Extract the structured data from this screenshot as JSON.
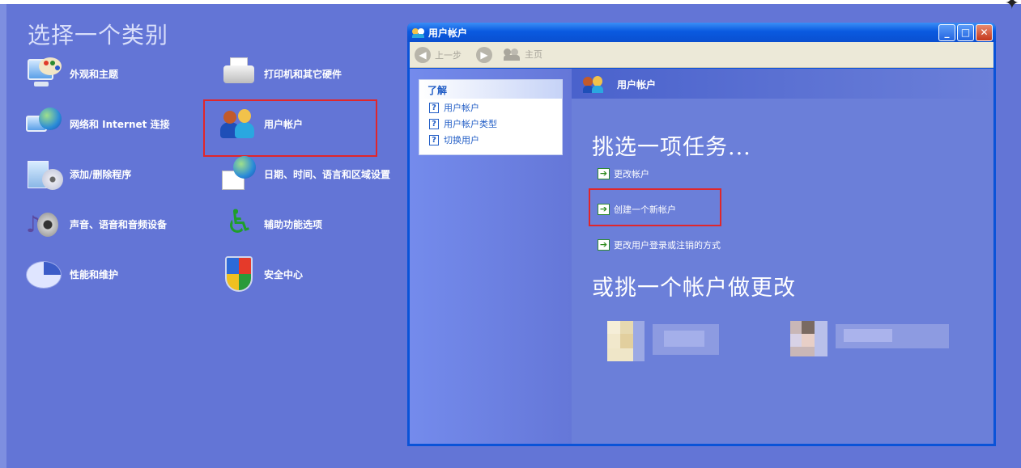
{
  "control_panel": {
    "title": "选择一个类别",
    "categories": [
      {
        "label": "外观和主题",
        "icon": "appearance-icon"
      },
      {
        "label": "打印机和其它硬件",
        "icon": "printer-icon"
      },
      {
        "label": "网络和 Internet 连接",
        "icon": "network-icon"
      },
      {
        "label": "用户帐户",
        "icon": "user-accounts-icon"
      },
      {
        "label": "添加/删除程序",
        "icon": "add-remove-programs-icon"
      },
      {
        "label": "日期、时间、语言和区域设置",
        "icon": "date-time-icon"
      },
      {
        "label": "声音、语音和音频设备",
        "icon": "sounds-icon"
      },
      {
        "label": "辅助功能选项",
        "icon": "accessibility-icon"
      },
      {
        "label": "性能和维护",
        "icon": "performance-icon"
      },
      {
        "label": "安全中心",
        "icon": "security-center-icon"
      }
    ]
  },
  "window": {
    "title": "用户帐户",
    "controls": {
      "minimize": "_",
      "maximize": "□",
      "close": "✕"
    },
    "toolbar": {
      "back": "上一步",
      "home": "主页"
    },
    "sidebar": {
      "heading": "了解",
      "items": [
        "用户帐户",
        "用户帐户类型",
        "切换用户"
      ]
    },
    "main": {
      "header": "用户帐户",
      "pick_task": "挑选一项任务...",
      "tasks": [
        "更改帐户",
        "创建一个新帐户",
        "更改用户登录或注销的方式"
      ],
      "pick_account": "或挑一个帐户做更改"
    }
  },
  "colors": {
    "desktop": "#6375d6",
    "titlebar": "#0a5ae0",
    "highlight_box": "#e0262b",
    "link": "#215dc6"
  }
}
